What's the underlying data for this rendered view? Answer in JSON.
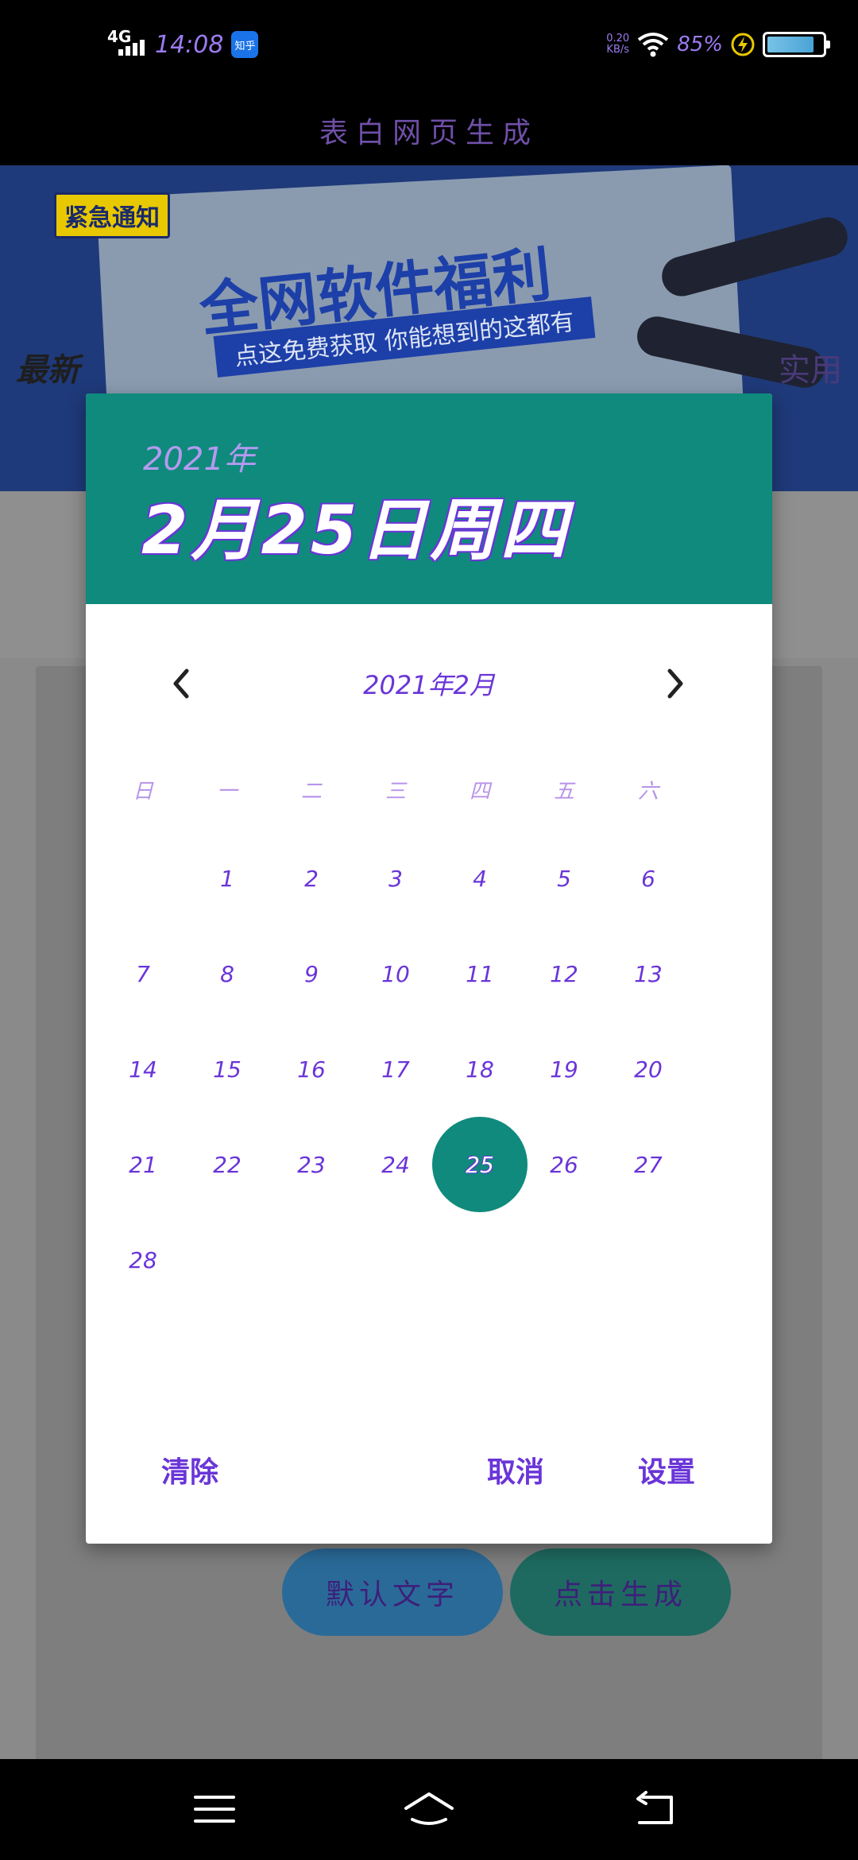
{
  "status_bar": {
    "network": "4G",
    "time": "14:08",
    "app_badge": "知乎",
    "net_speed_value": "0.20",
    "net_speed_unit": "KB/s",
    "battery_percent": "85%",
    "battery_level": 0.85,
    "charging": true
  },
  "app_header": {
    "title": "表白网页生成"
  },
  "background": {
    "banner_tag": "紧急通知",
    "banner_headline": "全网软件福利",
    "banner_sub": "点这免费获取 你能想到的这都有",
    "mid_left_text": "最新",
    "mid_right_text": "实用",
    "default_text_button": "默认文字",
    "generate_button": "点击生成"
  },
  "date_picker": {
    "selected_year": "2021年",
    "selected_date": "2月25日周四",
    "month_label": "2021年2月",
    "weekdays": [
      "日",
      "一",
      "二",
      "三",
      "四",
      "五",
      "六"
    ],
    "first_weekday_index": 1,
    "days_in_month": 28,
    "selected_day": 25,
    "actions": {
      "clear": "清除",
      "cancel": "取消",
      "set": "设置"
    },
    "accent_color": "#0f8a7c",
    "text_color": "#6a35d8"
  }
}
